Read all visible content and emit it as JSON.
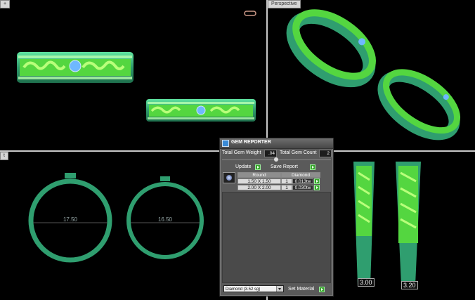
{
  "viewports": {
    "perspective_label": "Perspective",
    "top_left_dims": [
      "17.50",
      "16.50"
    ],
    "bottom_left_dims": [
      "17.50",
      "16.50"
    ],
    "bottom_right_dims": [
      "3.00",
      "3.20"
    ]
  },
  "gem_reporter": {
    "title": "GEM REPORTER",
    "total_weight_label": "Total Gem Weight",
    "total_weight_value": ".04",
    "total_count_label": "Total Gem Count",
    "total_count_value": "2",
    "update_label": "Update",
    "save_report_label": "Save Report",
    "columns": [
      "Round",
      "Diamond"
    ],
    "rows": [
      {
        "size": "1.50 X 1.50",
        "count": "1",
        "weight": "0.013tw"
      },
      {
        "size": "2.00 X 2.00",
        "count": "1",
        "weight": "0.030tw"
      }
    ],
    "material_value": "Diamond    (3.52 sg)",
    "set_material_label": "Set Material"
  },
  "colors": {
    "ring": "#2f9e6f",
    "accent": "#7cff5a",
    "gem": "#6fb8ff"
  }
}
